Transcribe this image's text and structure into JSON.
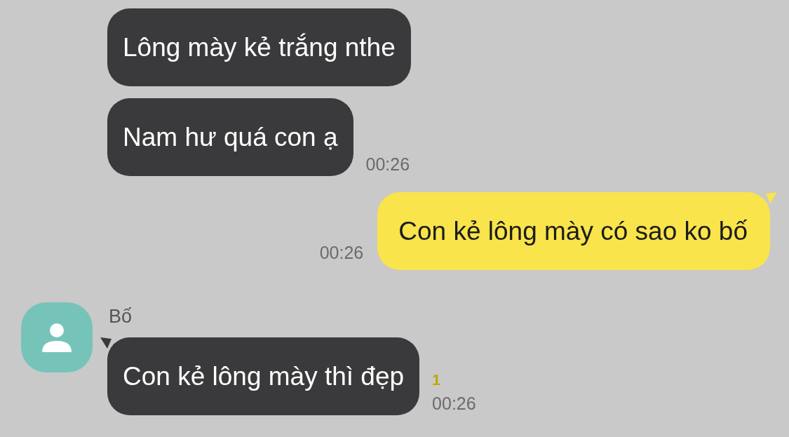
{
  "messages": [
    {
      "kind": "received",
      "tail": false,
      "text": "Lông mày kẻ trắng nthe"
    },
    {
      "kind": "received",
      "tail": false,
      "text": "Nam hư quá con ạ",
      "time": "00:26"
    },
    {
      "kind": "sent",
      "tail": true,
      "text": "Con kẻ lông mày có sao ko bố",
      "time": "00:26"
    },
    {
      "kind": "received",
      "tail": true,
      "sender": "Bố",
      "text": "Con kẻ lông mày thì đẹp",
      "unread": "1",
      "time": "00:26"
    }
  ]
}
